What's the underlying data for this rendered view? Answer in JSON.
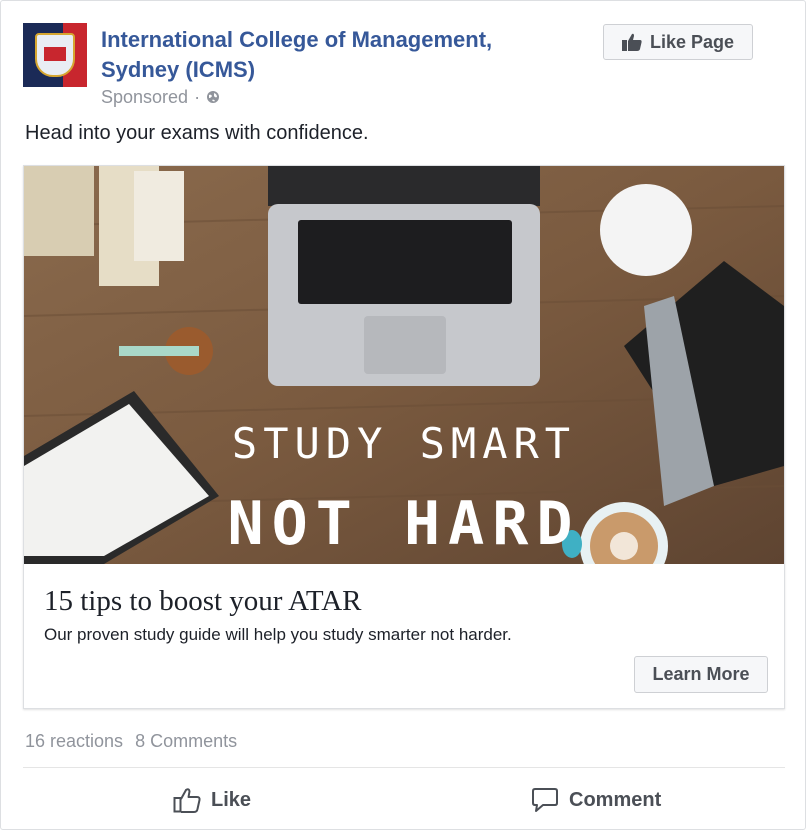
{
  "post": {
    "page_name": "International College of Management, Sydney (ICMS)",
    "sponsored_label": "Sponsored",
    "privacy_icon": "globe-icon",
    "like_page_label": "Like Page",
    "caption": "Head into your exams with confidence."
  },
  "image": {
    "overlay_line1": "STUDY SMART",
    "overlay_line2": "NOT HARD"
  },
  "attachment": {
    "headline": "15 tips to boost your ATAR",
    "description": "Our proven study guide will help you study smarter not harder.",
    "cta_label": "Learn More"
  },
  "stats": {
    "reactions": "16 reactions",
    "comments": "8 Comments"
  },
  "actions": {
    "like_label": "Like",
    "comment_label": "Comment"
  },
  "colors": {
    "link": "#365899",
    "meta": "#90949c",
    "button_text": "#4b4f56",
    "button_bg": "#f6f7f9"
  }
}
